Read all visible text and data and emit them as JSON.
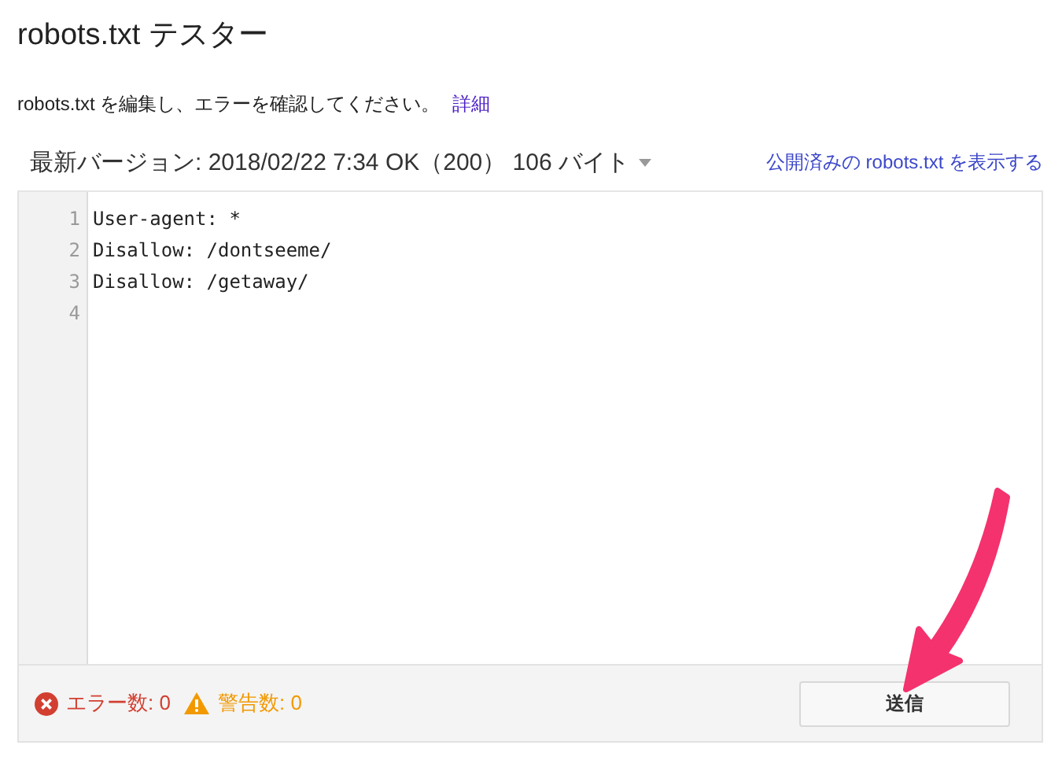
{
  "title": "robots.txt テスター",
  "description": {
    "text": "robots.txt を編集し、エラーを確認してください。",
    "link": "詳細"
  },
  "version": {
    "label": "最新バージョン: 2018/02/22 7:34 OK（200） 106 バイト",
    "link": "公開済みの robots.txt を表示する"
  },
  "editor": {
    "lines": [
      {
        "number": "1",
        "text": "User-agent: *"
      },
      {
        "number": "2",
        "text": "Disallow: /dontseeme/"
      },
      {
        "number": "3",
        "text": "Disallow: /getaway/"
      },
      {
        "number": "4"
      }
    ]
  },
  "status": {
    "errors": "エラー数: 0",
    "warnings": "警告数: 0"
  },
  "submit_button": "送信"
}
